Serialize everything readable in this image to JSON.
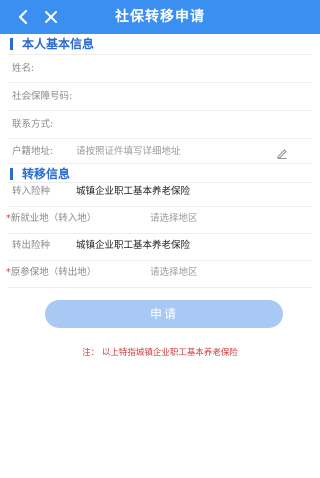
{
  "header": {
    "title": "社保转移申请"
  },
  "sections": {
    "basic": {
      "title": "本人基本信息",
      "fields": [
        {
          "label": "姓名:",
          "value": ""
        },
        {
          "label": "社会保障号码:",
          "value": ""
        },
        {
          "label": "联系方式:",
          "value": ""
        },
        {
          "label": "户籍地址:",
          "placeholder": "请按照证件填写详细地址"
        }
      ]
    },
    "transfer": {
      "title": "转移信息",
      "fields": [
        {
          "required": false,
          "label": "转入险种",
          "value": "城镇企业职工基本养老保险"
        },
        {
          "required": true,
          "label": "新就业地（转入地）",
          "value": "请选择地区"
        },
        {
          "required": false,
          "label": "转出险种",
          "value": "城镇企业职工基本养老保险"
        },
        {
          "required": true,
          "label": "原参保地（转出地）",
          "value": "请选择地区"
        }
      ]
    }
  },
  "submit_label": "申请",
  "note": "注：  以上特指城镇企业职工基本养老保险",
  "colors": {
    "header": "#3a8ff0",
    "section": "#2a6ad1",
    "button": "#a9c9f5",
    "required": "#e03a3a",
    "note": "#d23a3a"
  },
  "icons": {
    "back": "chevron-left-icon",
    "close": "close-icon",
    "edit": "pencil-icon"
  }
}
